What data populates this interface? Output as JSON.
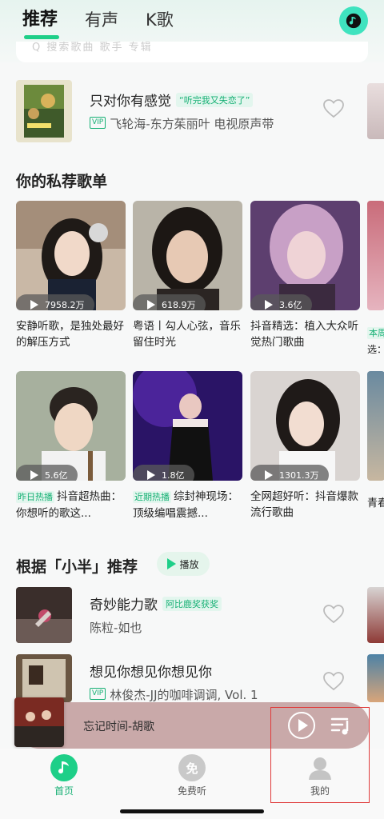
{
  "header": {
    "tabs": [
      {
        "label": "推荐",
        "active": true
      },
      {
        "label": "有声",
        "active": false
      },
      {
        "label": "K歌",
        "active": false
      }
    ],
    "accent": "#1ecf88"
  },
  "search": {
    "placeholder": "Q 搜索歌曲 歌手 专辑"
  },
  "top_song": {
    "title": "只对你有感觉",
    "tag": "“听完我又失恋了”",
    "vip": "VIP",
    "artist": "飞轮海-东方茱丽叶 电视原声带"
  },
  "private_section": {
    "title": "你的私荐歌单",
    "cards": [
      {
        "plays": "7958.2万",
        "title": "安静听歌，是独处最好的解压方式",
        "hot": ""
      },
      {
        "plays": "618.9万",
        "title": "粤语丨勾人心弦，音乐留住时光",
        "hot": ""
      },
      {
        "plays": "3.6亿",
        "title": "抖音精选：植入大众听觉热门歌曲",
        "hot": ""
      },
      {
        "plays": "5.6亿",
        "title": "抖音超热曲：你想听的歌这...",
        "hot": "昨日热播"
      },
      {
        "plays": "1.8亿",
        "title": "综封神现场：顶级编唱震撼...",
        "hot": "近期热播"
      },
      {
        "plays": "1301.3万",
        "title": "全网超好听：抖音爆款流行歌曲",
        "hot": ""
      }
    ],
    "peek_titles": [
      {
        "hot": "本周",
        "text": "选：",
        "hot_label": "本周"
      },
      {
        "text": "青春的歌"
      }
    ]
  },
  "recommend_section": {
    "title": "根据「小半」推荐",
    "play_label": "播放",
    "songs": [
      {
        "title": "奇妙能力歌",
        "tag": "阿比鹿奖获奖",
        "artist": "陈粒-如也",
        "vip": ""
      },
      {
        "title": "想见你想见你想见你",
        "tag": "",
        "artist": "林俊杰-JJ的咖啡调调, Vol. 1",
        "vip": "VIP"
      }
    ]
  },
  "mini_player": {
    "title": "忘记时间-胡歌"
  },
  "bottom_nav": [
    {
      "label": "首页",
      "icon": "home-note-icon",
      "active": true
    },
    {
      "label": "免费听",
      "icon": "free-listen-icon",
      "active": false
    },
    {
      "label": "我的",
      "icon": "profile-icon",
      "active": false
    }
  ]
}
